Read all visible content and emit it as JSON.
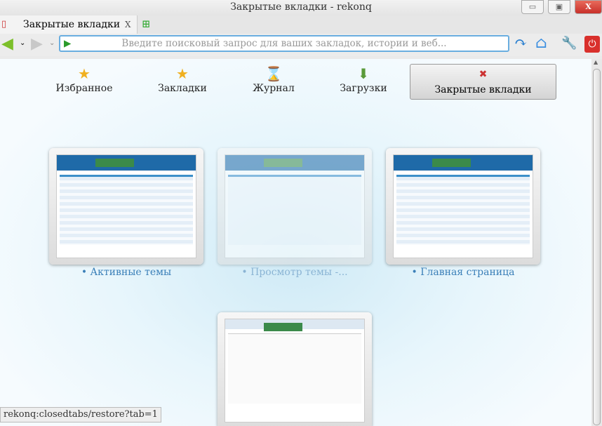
{
  "window": {
    "title": "Закрытые вкладки - rekonq",
    "minimize": "▭",
    "maximize": "▣",
    "close": "X"
  },
  "tabs": [
    {
      "label": "Закрытые вкладки",
      "close": "X"
    }
  ],
  "toolbar": {
    "url_placeholder": "Введите поисковый запрос для ваших закладок, истории и веб..."
  },
  "nav": {
    "favorites": "Избранное",
    "bookmarks": "Закладки",
    "history": "Журнал",
    "downloads": "Загрузки",
    "closed_tabs": "Закрытые вкладки"
  },
  "previews": [
    {
      "label": "• Активные темы",
      "faded": false
    },
    {
      "label": "• Просмотр темы -...",
      "faded": true
    },
    {
      "label": "• Главная страница",
      "faded": false
    },
    {
      "label": "",
      "faded": false
    }
  ],
  "status": "rekonq:closedtabs/restore?tab=1",
  "colors": {
    "accent": "#3a7fb8",
    "url_border": "#6aaee0",
    "close": "#d9302c"
  }
}
